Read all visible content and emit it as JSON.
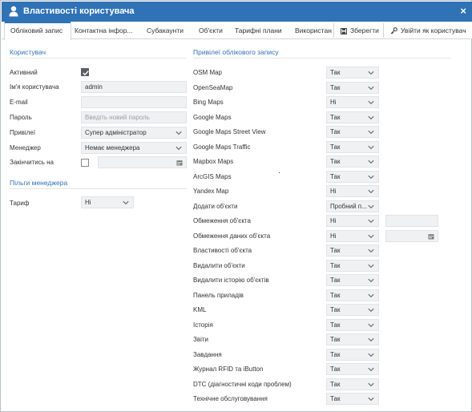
{
  "window": {
    "title": "Властивості користувача",
    "close_glyph": "×",
    "icon": "user-icon"
  },
  "tabs": [
    {
      "label": "Обліковий запис",
      "active": true
    },
    {
      "label": "Контактна інфор...",
      "active": false
    },
    {
      "label": "Субакаунти",
      "active": false
    },
    {
      "label": "Об'єкти",
      "active": false
    },
    {
      "label": "Тарифні плани",
      "active": false
    },
    {
      "label": "Використан",
      "active": false
    }
  ],
  "toolbar": {
    "save_label": "Зберегти",
    "save_icon": "floppy-disk-icon",
    "login_as_label": "Увійти як користувач",
    "login_as_icon": "key-icon"
  },
  "user_section": {
    "title": "Користувач",
    "active_label": "Активний",
    "active_checked": true,
    "username_label": "Ім'я користувача",
    "username_value": "admin",
    "email_label": "E-mail",
    "email_value": "",
    "password_label": "Пароль",
    "password_placeholder": "Введіть новий пароль",
    "privileges_label": "Привілеї",
    "privileges_value": "Супер адміністратор",
    "manager_label": "Менеджер",
    "manager_value": "Немає менеджера",
    "expires_label": "Закінчитись на",
    "expires_checked": false,
    "expires_value": ""
  },
  "manager_benefits": {
    "title": "Пільги менеджера",
    "tariff_label": "Тариф",
    "tariff_value": "Ні"
  },
  "privileges_section": {
    "title": "Привілеї облікового запису",
    "rows": [
      {
        "label": "OSM Map",
        "value": "Так"
      },
      {
        "label": "OpenSeaMap",
        "value": "Так"
      },
      {
        "label": "Bing Maps",
        "value": "Ні"
      },
      {
        "label": "Google Maps",
        "value": "Так"
      },
      {
        "label": "Google Maps Street View",
        "value": "Так"
      },
      {
        "label": "Google Maps Traffic",
        "value": "Так"
      },
      {
        "label": "Mapbox Maps",
        "value": "Так"
      },
      {
        "label": "ArcGIS Maps",
        "value": "Так"
      },
      {
        "label": "Yandex Map",
        "value": "Ні"
      },
      {
        "label": "Додати об'єкти",
        "value": "Пробний п..."
      },
      {
        "label": "Обмеження об'єкта",
        "value": "Ні",
        "extra": "input"
      },
      {
        "label": "Обмеження даних об'єкта",
        "value": "Ні",
        "extra": "date"
      },
      {
        "label": "Властивості об'єкта",
        "value": "Так"
      },
      {
        "label": "Видалити об'єкти",
        "value": "Так"
      },
      {
        "label": "Видалити історію об'єктів",
        "value": "Так"
      },
      {
        "label": "Панель приладів",
        "value": "Так"
      },
      {
        "label": "KML",
        "value": "Так"
      },
      {
        "label": "Історія",
        "value": "Так"
      },
      {
        "label": "Звіти",
        "value": "Так"
      },
      {
        "label": "Завдання",
        "value": "Так"
      },
      {
        "label": "Журнал RFID та iButton",
        "value": "Так"
      },
      {
        "label": "DTC (діагностичні коди проблем)",
        "value": "Так"
      },
      {
        "label": "Технічне обслуговування",
        "value": "Так"
      }
    ]
  },
  "colors": {
    "titlebar": "#2f72b6",
    "accent": "#2f72b6",
    "field_bg": "#f0f1f2"
  }
}
